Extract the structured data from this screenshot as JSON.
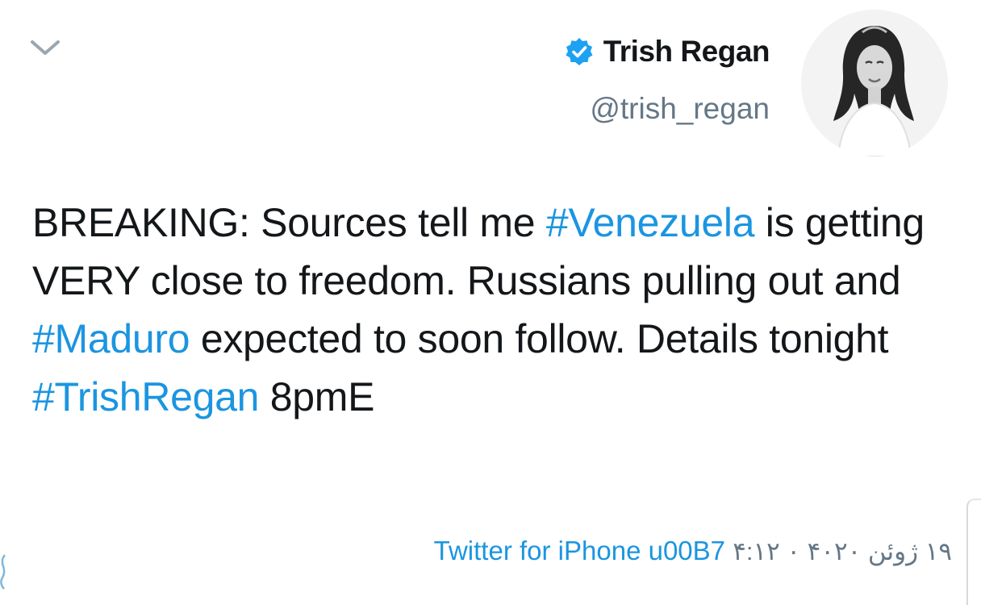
{
  "tweet": {
    "icons": {
      "caret": "chevron-down-icon",
      "verified": "verified-badge-icon",
      "avatar": "profile-photo"
    },
    "author": {
      "display_name": "Trish Regan",
      "handle": "@trish_regan"
    },
    "text": {
      "p1": "BREAKING: Sources tell me ",
      "tag1": "#Venezuela",
      "p2": " is getting VERY close to freedom. Russians pulling out and ",
      "tag2": "#Maduro",
      "p3": " expected to soon follow. Details tonight ",
      "tag3": "#TrishRegan",
      "p4": " 8pmE"
    },
    "meta": {
      "source": "Twitter for iPhone u00B7",
      "date": "۱۹ ژوئن ۴۰۲۰ ۰ ۴:۱۲"
    },
    "colors": {
      "link": "#1b95e0",
      "text": "#14171a",
      "secondary": "#657786",
      "verified": "#1da1f2"
    }
  }
}
